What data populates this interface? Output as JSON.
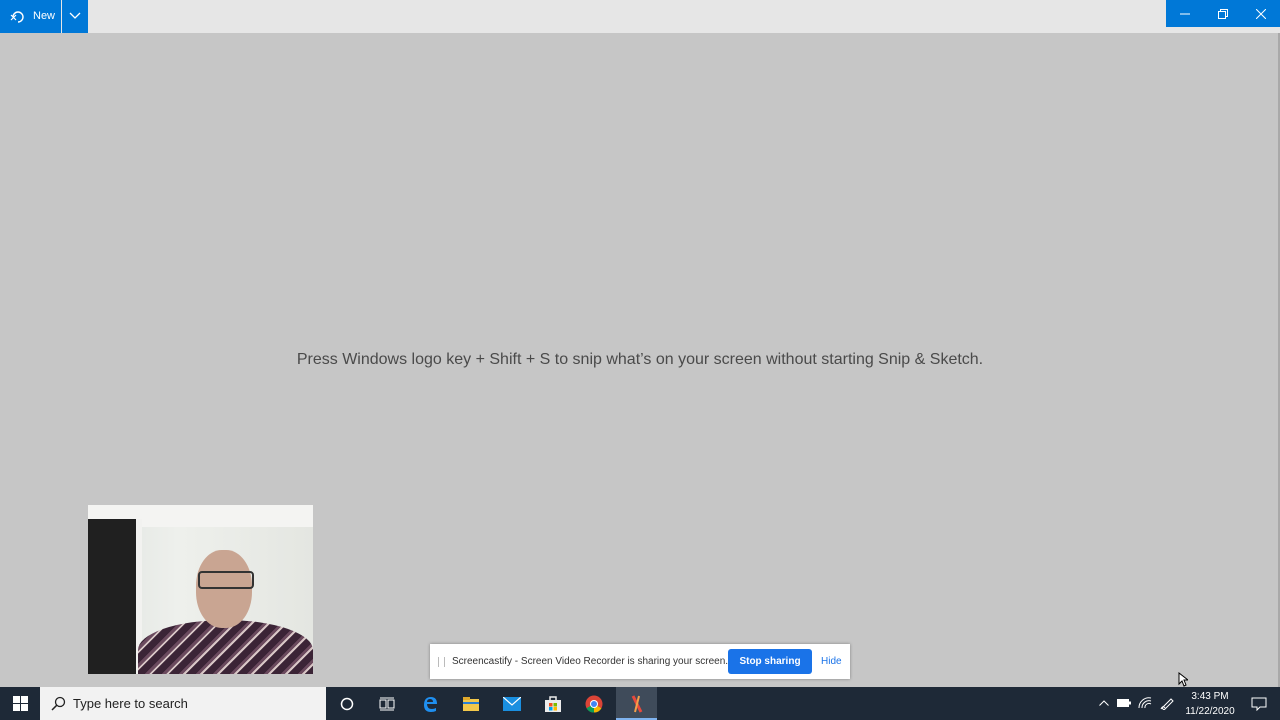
{
  "titlebar": {
    "new_label": "New"
  },
  "main": {
    "hint": "Press Windows logo key + Shift + S to snip what’s on your screen without starting Snip & Sketch."
  },
  "share_bar": {
    "message": "Screencastify - Screen Video Recorder is sharing your screen.",
    "stop_label": "Stop sharing",
    "hide_label": "Hide"
  },
  "taskbar": {
    "search_placeholder": "Type here to search",
    "apps": [
      "cortana-icon",
      "task-view-icon",
      "edge-icon",
      "file-explorer-icon",
      "mail-icon",
      "store-icon",
      "chrome-icon",
      "snip-sketch-icon"
    ],
    "time": "3:43 PM",
    "date": "11/22/2020"
  },
  "colors": {
    "accent": "#0078d7",
    "canvas": "#c6c6c6",
    "taskbar": "#1e2937",
    "share_button": "#1a73e8"
  }
}
